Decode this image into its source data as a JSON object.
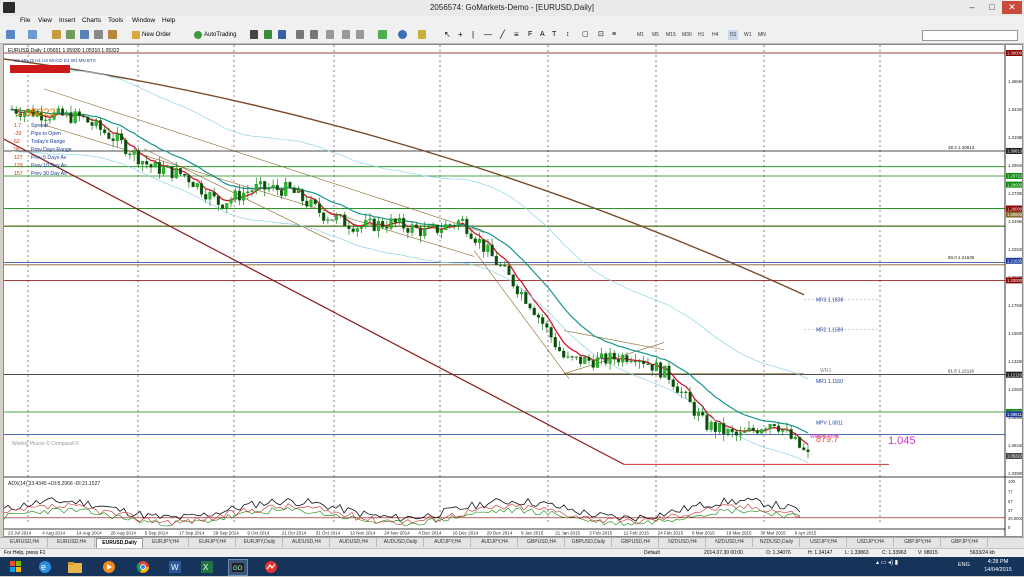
{
  "window": {
    "title": "2056574: GoMarkets-Demo - [EURUSD,Daily]",
    "menus": [
      "File",
      "View",
      "Insert",
      "Charts",
      "Tools",
      "Window",
      "Help"
    ]
  },
  "toolbar": {
    "new_order_label": "New Order",
    "autotrading_label": "AutoTrading",
    "timeframes": [
      "M1",
      "M5",
      "M15",
      "M30",
      "H1",
      "H4",
      "D1",
      "W1",
      "MN"
    ]
  },
  "chart": {
    "header": "EURUSD,Daily  1.05651 1.05930 1.05310 1.05322",
    "info_top": [
      "M1",
      "M5",
      "15",
      "H1",
      "H4",
      "MACD",
      "D1",
      "W1",
      "MN",
      "BTS"
    ],
    "price_big": "1.05322",
    "info_panel": [
      {
        "value": "1.7",
        "label": "Spread"
      },
      {
        "value": "-33",
        "label": "Pips to Open"
      },
      {
        "value": "62",
        "label": "Today's Range"
      },
      {
        "value": "98",
        "label": "Prev Days Range"
      },
      {
        "value": "127",
        "label": "Prev 5 Days Av"
      },
      {
        "value": "129",
        "label": "Prev 10 Day Av"
      },
      {
        "value": "157",
        "label": "Prev 30 Day Av"
      }
    ],
    "price_axis": [
      "1.39000",
      "1.36660",
      "1.34320",
      "1.31980",
      "1.29640",
      "1.27300",
      "1.24960",
      "1.22620",
      "1.20280",
      "1.17940",
      "1.15600",
      "1.13260",
      "1.10920",
      "1.08580",
      "1.06240",
      "1.03900"
    ],
    "price_tags": [
      "1.39000",
      "1.30813",
      "1.28722",
      "1.28000",
      "1.26000",
      "1.25500",
      "1.21635",
      "1.20000",
      "1.12116",
      "1.09000",
      "1.08811",
      "1.05322"
    ],
    "date_axis": [
      "23 Jul 2014",
      "4 Aug 2014",
      "14 Aug 2014",
      "26 Aug 2014",
      "5 Sep 2014",
      "17 Sep 2014",
      "29 Sep 2014",
      "9 Oct 2014",
      "21 Oct 2014",
      "31 Oct 2014",
      "12 Nov 2014",
      "24 Nov 2014",
      "4 Dec 2014",
      "16 Dec 2014",
      "29 Dec 2014",
      "9 Jan 2015",
      "21 Jan 2015",
      "2 Feb 2015",
      "12 Feb 2015",
      "24 Feb 2015",
      "6 Mar 2015",
      "18 Mar 2015",
      "30 Mar 2015",
      "9 Apr 2015"
    ],
    "fib_labels": [
      "38.2  1.30813",
      "50.0  1.21635",
      "61.8  1.12116"
    ],
    "pivot_labels": [
      "MR3  1.1838",
      "MR2  1.1589",
      "MR1  1.1160",
      "WR3",
      "MPV  1.0811",
      "Weekly Pivot"
    ],
    "target_label": "1.045",
    "pips_label": "879.7",
    "watermark": "Weekly Plusos © CompassFX",
    "adx_label": "ADX(14) 33.4345  +DI:8.2966  -DI:21.1527",
    "adx_axis": [
      "100",
      "77",
      "57",
      "37",
      "20.0000",
      "0"
    ]
  },
  "chart_data": {
    "type": "line",
    "title": "EURUSD,Daily",
    "xlabel": "",
    "ylabel": "",
    "x": [
      "23 Jul 2014",
      "4 Aug 2014",
      "14 Aug 2014",
      "26 Aug 2014",
      "5 Sep 2014",
      "17 Sep 2014",
      "29 Sep 2014",
      "9 Oct 2014",
      "21 Oct 2014",
      "31 Oct 2014",
      "12 Nov 2014",
      "24 Nov 2014",
      "4 Dec 2014",
      "16 Dec 2014",
      "29 Dec 2014",
      "9 Jan 2015",
      "21 Jan 2015",
      "2 Feb 2015",
      "12 Feb 2015",
      "24 Feb 2015",
      "6 Mar 2015",
      "18 Mar 2015",
      "30 Mar 2015",
      "9 Apr 2015"
    ],
    "series": [
      {
        "name": "EURUSD",
        "values": [
          1.343,
          1.3385,
          1.336,
          1.318,
          1.295,
          1.288,
          1.264,
          1.277,
          1.276,
          1.255,
          1.245,
          1.248,
          1.24,
          1.25,
          1.215,
          1.18,
          1.133,
          1.133,
          1.138,
          1.12,
          1.08,
          1.069,
          1.083,
          1.0532
        ]
      }
    ],
    "ylim": [
      1.039,
      1.39
    ]
  },
  "tabs": [
    "EURUSD,H4",
    "EURUSD,H4",
    "EURUSD,Daily",
    "EURJPY,H4",
    "EURJPY,H4",
    "EURJPY,Daily",
    "AUDUSD,H4",
    "AUDUSD,H4",
    "AUDUSD,Daily",
    "AUDJPY,H4",
    "AUDJPY,H4",
    "GBPUSD,H4",
    "GBPUSD,Daily",
    "GBPUSD,H4",
    "NZDUSD,H4",
    "NZDUSD,H4",
    "NZDUSD,Daily",
    "USDJPY,H4",
    "USDJPY,H4",
    "GBPJPY,H4",
    "GBPJPY,H4"
  ],
  "status": {
    "help": "For Help, press F1",
    "profile": "Default",
    "datetime": "2014.07.30 00:00",
    "open": "O: 1.34076",
    "high": "H: 1.34147",
    "low": "L: 1.33863",
    "close": "C: 1.33963",
    "volume": "V: 98015",
    "traffic": "5633/24 kb"
  },
  "taskbar": {
    "lang": "ENG",
    "time": "4:28 PM",
    "date": "14/04/2015"
  }
}
